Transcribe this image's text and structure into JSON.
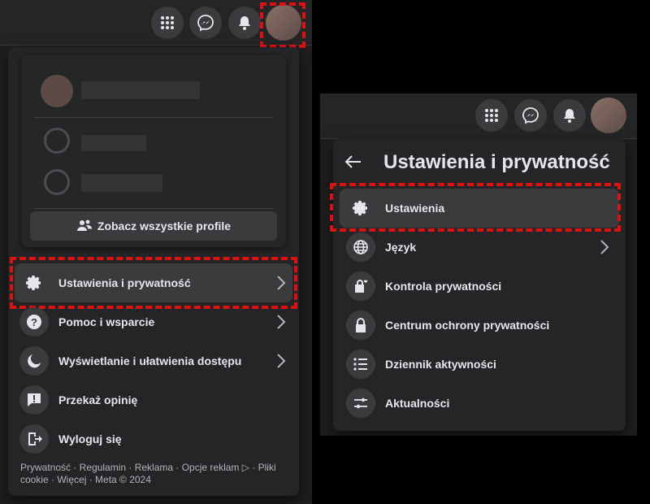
{
  "left": {
    "see_all_profiles": "Zobacz wszystkie profile",
    "menu": [
      {
        "label": "Ustawienia i prywatność",
        "chevron": true
      },
      {
        "label": "Pomoc i wsparcie",
        "chevron": true
      },
      {
        "label": "Wyświetlanie i ułatwienia dostępu",
        "chevron": true
      },
      {
        "label": "Przekaż opinię",
        "chevron": false
      },
      {
        "label": "Wyloguj się",
        "chevron": false
      }
    ],
    "footer": {
      "line1": "Prywatność · Regulamin · Reklama · Opcje reklam ▷ · Pliki",
      "line2": "cookie · Więcej · Meta © 2024"
    }
  },
  "right": {
    "title": "Ustawienia i prywatność",
    "menu": [
      {
        "label": "Ustawienia",
        "chevron": false
      },
      {
        "label": "Język",
        "chevron": true
      },
      {
        "label": "Kontrola prywatności",
        "chevron": false
      },
      {
        "label": "Centrum ochrony prywatności",
        "chevron": false
      },
      {
        "label": "Dziennik aktywności",
        "chevron": false
      },
      {
        "label": "Aktualności",
        "chevron": false
      }
    ]
  },
  "icons": {
    "topbar": [
      "grid-icon",
      "messenger-icon",
      "bell-icon"
    ]
  },
  "colors": {
    "highlight": "#e01010",
    "panel": "#242526",
    "button": "#3a3b3c"
  }
}
